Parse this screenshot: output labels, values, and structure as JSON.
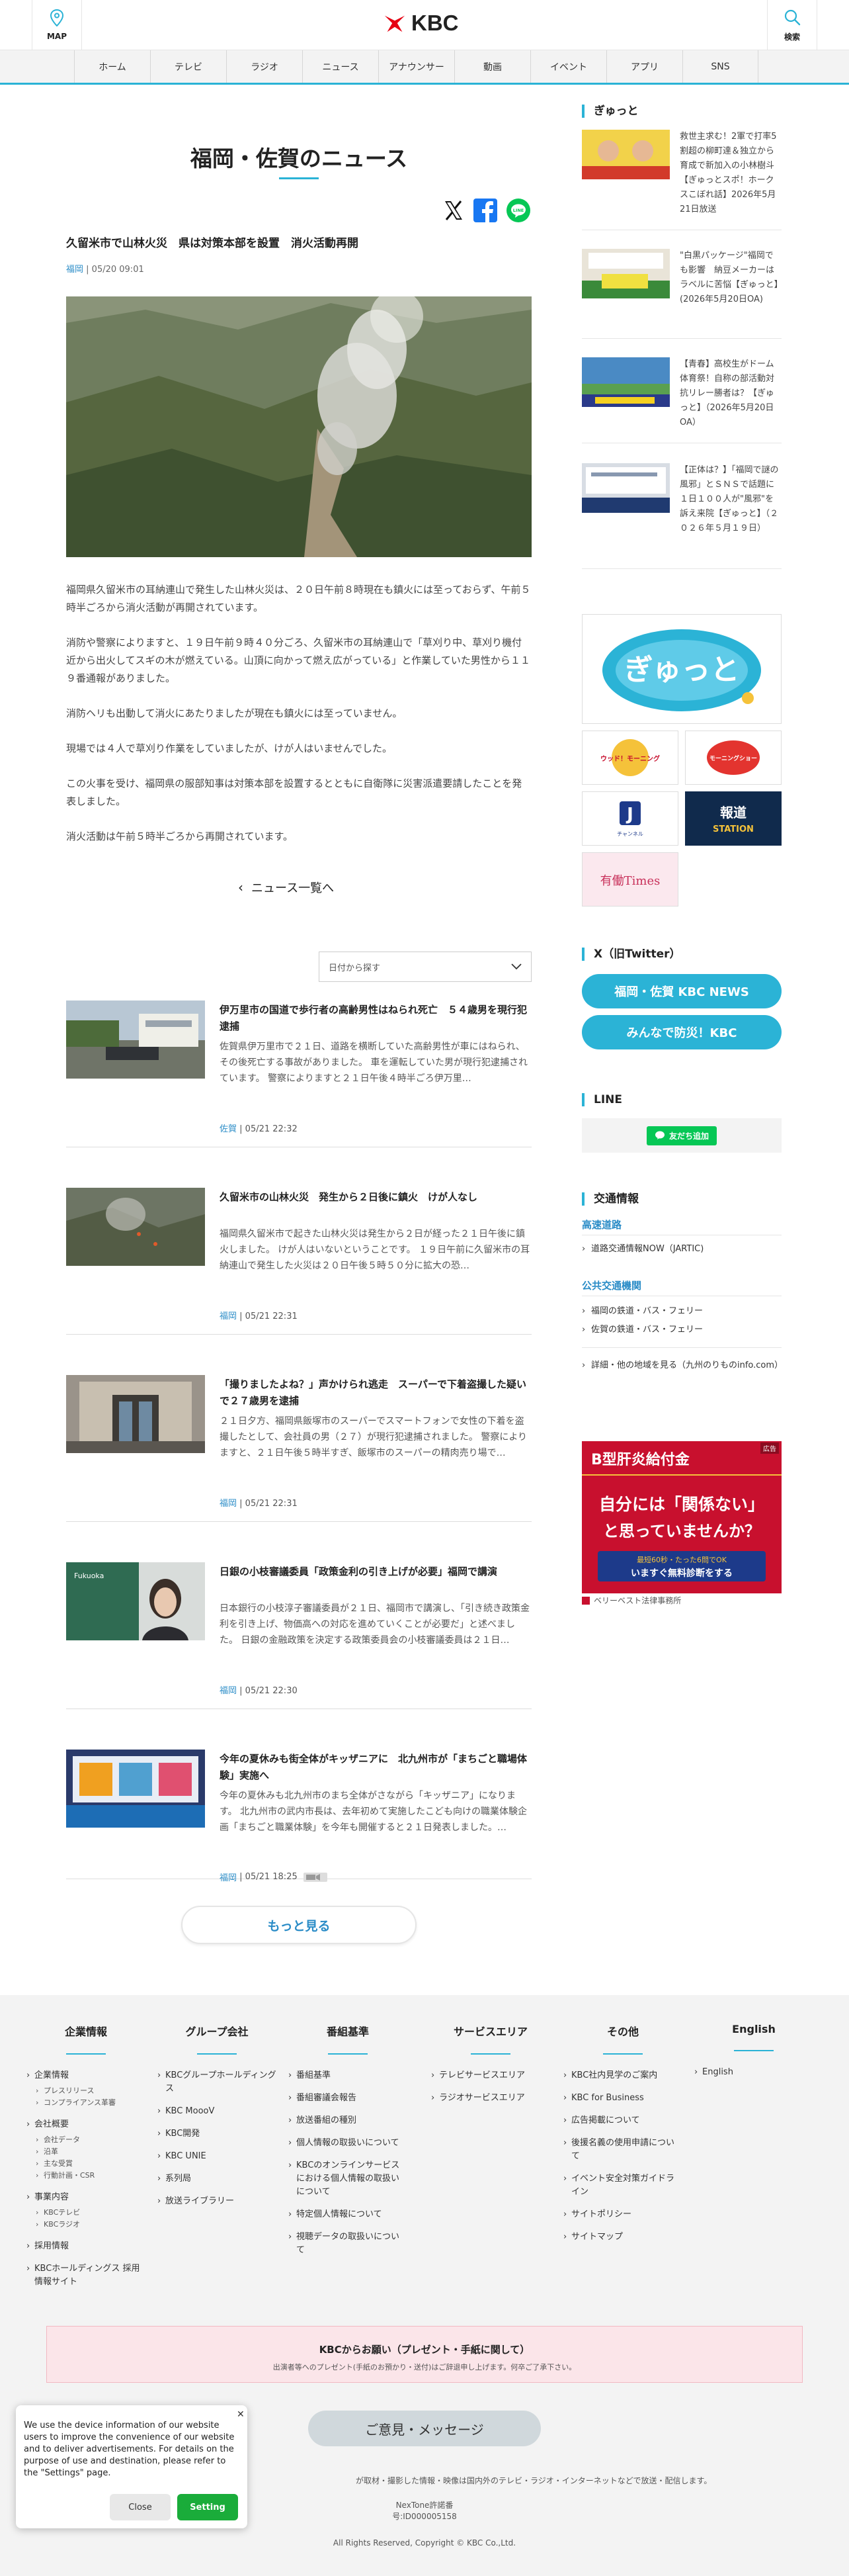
{
  "header": {
    "map_label": "MAP",
    "logo_text": "KBC",
    "search_label": "検索"
  },
  "nav": {
    "items": [
      "ホーム",
      "テレビ",
      "ラジオ",
      "ニュース",
      "アナウンサー",
      "動画",
      "イベント",
      "アプリ",
      "SNS"
    ]
  },
  "main": {
    "page_title": "福岡・佐賀のニュース",
    "article": {
      "title": "久留米市で山林火災　県は対策本部を設置　消火活動再開",
      "category": "福岡",
      "date": "05/20 09:01",
      "paragraphs": [
        "福岡県久留米市の耳納連山で発生した山林火災は、２０日午前８時現在も鎮火には至っておらず、午前５時半ごろから消火活動が再開されています。",
        "消防や警察によりますと、１９日午前９時４０分ごろ、久留米市の耳納連山で「草刈り中、草刈り機付近から出火してスギの木が燃えている。山頂に向かって燃え広がっている」と作業していた男性から１１９番通報がありました。",
        "消防ヘリも出動して消火にあたりましたが現在も鎮火には至っていません。",
        "現場では４人で草刈り作業をしていましたが、けが人はいませんでした。",
        "この火事を受け、福岡県の服部知事は対策本部を設置するとともに自衛隊に災害派遣要請したことを発表しました。",
        "消火活動は午前５時半ごろから再開されています。"
      ]
    },
    "back_link": "ニュース一覧へ",
    "date_select": "日付から探す",
    "news": [
      {
        "title": "伊万里市の国道で歩行者の高齢男性はねられ死亡　５４歳男を現行犯逮捕",
        "excerpt": "佐賀県伊万里市で２１日、道路を横断していた高齢男性が車にはねられ、その後死亡する事故がありました。 車を運転していた男が現行犯逮捕されています。 警察によりますと２１日午後４時半ごろ伊万里…",
        "category": "佐賀",
        "date": "05/21 22:32"
      },
      {
        "title": "久留米市の山林火災　発生から２日後に鎮火　けが人なし",
        "excerpt": "福岡県久留米市で起きた山林火災は発生から２日が経った２１日午後に鎮火しました。 けが人はいないということです。 １９日午前に久留米市の耳納連山で発生した火災は２０日午後５時５０分に拡大の恐…",
        "category": "福岡",
        "date": "05/21 22:31"
      },
      {
        "title": "「撮りましたよね？」声かけられ逃走　スーパーで下着盗撮した疑いで２７歳男を逮捕",
        "excerpt": "２１日夕方、福岡県飯塚市のスーパーでスマートフォンで女性の下着を盗撮したとして、会社員の男（２７）が現行犯逮捕されました。 警察によりますと、２１日午後５時半すぎ、飯塚市のスーパーの精肉売り場で…",
        "category": "福岡",
        "date": "05/21 22:31"
      },
      {
        "title": "日銀の小枝審議委員「政策金利の引き上げが必要」福岡で講演",
        "excerpt": "日本銀行の小枝淳子審議委員が２１日、福岡市で講演し、「引き続き政策金利を引き上げ、物価高への対応を進めていくことが必要だ」と述べました。 日銀の金融政策を決定する政策委員会の小枝審議委員は２１日…",
        "category": "福岡",
        "date": "05/21 22:30"
      },
      {
        "title": "今年の夏休みも街全体がキッザニアに　北九州市が「まちごと職場体験」実施へ",
        "excerpt": "今年の夏休みも北九州市のまち全体がさながら「キッザニア」になります。 北九州市の武内市長は、去年初めて実施したこども向けの職業体験企画「まちごと職業体験」を今年も開催すると２１日発表しました。…",
        "category": "福岡",
        "date": "05/21 18:25"
      }
    ],
    "more_button": "もっと見る"
  },
  "sidebar": {
    "gyutto_head": "ぎゅっと",
    "gyutto_items": [
      "救世主求む！2軍で打率5割超の柳町達＆独立から育成で新加入の小林樹斗【ぎゅっとスポ！ホークスこぼれ話】2026年5月21日放送",
      "\"白黒パッケージ\"福岡でも影響　納豆メーカーはラベルに苦悩【ぎゅっと】(2026年5月20日OA)",
      "【青春】高校生がドーム体育祭！自称の部活動対抗リレー勝者は？【ぎゅっと】（2026年5月20日OA）",
      "【正体は？】「福岡で謎の風邪」とＳＮＳで話題に　１日１００人が\"風邪\"を訴え来院【ぎゅっと】（２０２６年５月１９日）"
    ],
    "banners": {
      "gyutto_logo": "ぎゅっと",
      "wakuwaku": "ウッド！モーニング",
      "morning_show": "モーニングショー",
      "j_channel": "チャンネル",
      "houdou_top": "報道",
      "houdou_bottom": "STATION",
      "times": "有働Times"
    },
    "x_head": "X（旧Twitter）",
    "x_buttons": [
      "福岡・佐賀 KBC NEWS",
      "みんなで防災！KBC"
    ],
    "line_head": "LINE",
    "line_add": "友だち追加",
    "traffic_head": "交通情報",
    "traffic_road": "高速道路",
    "traffic_road_link": "道路交通情報NOW（JARTIC)",
    "traffic_public": "公共交通機関",
    "traffic_links": [
      "福岡の鉄道・バス・フェリー",
      "佐賀の鉄道・バス・フェリー"
    ],
    "traffic_other": "詳細・他の地域を見る（九州のりものinfo.com）",
    "ad": {
      "label": "広告",
      "title": "B型肝炎給付金",
      "line1": "自分には「関係ない」",
      "line2": "と思っていませんか？",
      "cta_top": "最短60秒・たった6問でOK",
      "cta": "いますぐ無料診断をする",
      "sponsor": "ベリーベスト法律事務所"
    }
  },
  "footer": {
    "columns": [
      {
        "title": "企業情報",
        "groups": [
          {
            "link": "企業情報",
            "subs": [
              "プレスリリース",
              "コンプライアンス革審"
            ]
          },
          {
            "link": "会社概要",
            "subs": [
              "会社データ",
              "沿革",
              "主な受賞",
              "行動計画・CSR"
            ]
          },
          {
            "link": "事業内容",
            "subs": [
              "KBCテレビ",
              "KBCラジオ"
            ]
          },
          {
            "link": "採用情報",
            "subs": []
          },
          {
            "link": "KBCホールディングス 採用情報サイト",
            "subs": []
          }
        ]
      },
      {
        "title": "グループ会社",
        "groups": [
          {
            "link": "KBCグループホールディングス",
            "subs": []
          },
          {
            "link": "KBC MoooV",
            "subs": []
          },
          {
            "link": "KBC開発",
            "subs": []
          },
          {
            "link": "KBC UNIE",
            "subs": []
          },
          {
            "link": "系列局",
            "subs": []
          },
          {
            "link": "放送ライブラリー",
            "subs": []
          }
        ]
      },
      {
        "title": "番組基準",
        "groups": [
          {
            "link": "番組基準",
            "subs": []
          },
          {
            "link": "番組審議会報告",
            "subs": []
          },
          {
            "link": "放送番組の種別",
            "subs": []
          },
          {
            "link": "個人情報の取扱いについて",
            "subs": []
          },
          {
            "link": "KBCのオンラインサービスにおける個人情報の取扱いについて",
            "subs": []
          },
          {
            "link": "特定個人情報について",
            "subs": []
          },
          {
            "link": "視聴データの取扱いについて",
            "subs": []
          }
        ]
      },
      {
        "title": "サービスエリア",
        "groups": [
          {
            "link": "テレビサービスエリア",
            "subs": []
          },
          {
            "link": "ラジオサービスエリア",
            "subs": []
          }
        ]
      },
      {
        "title": "その他",
        "groups": [
          {
            "link": "KBC社内見学のご案内",
            "subs": []
          },
          {
            "link": "KBC for Business",
            "subs": []
          },
          {
            "link": "広告掲載について",
            "subs": []
          },
          {
            "link": "後援名義の使用申請について",
            "subs": []
          },
          {
            "link": "イベント安全対策ガイドライン",
            "subs": []
          },
          {
            "link": "サイトポリシー",
            "subs": []
          },
          {
            "link": "サイトマップ",
            "subs": []
          }
        ]
      },
      {
        "title": "English",
        "groups": [
          {
            "link": "English",
            "subs": []
          }
        ]
      }
    ],
    "present_title": "KBCからお願い（プレゼント・手紙に関して）",
    "present_sub": "出演者等へのプレゼント(手紙のお預かり・送付)はご辞退申し上げます。何卒ご了承下さい。",
    "opinion": "ご意見・メッセージ",
    "notice": "が取材・撮影した情報・映像は国内外のテレビ・ラジオ・インターネットなどで放送・配信します。",
    "license": "NexTone許諾番号:ID000005158",
    "copyright": "All Rights Reserved, Copyright © KBC Co.,Ltd."
  },
  "cookie": {
    "message": "We use the device information of our website users to improve the convenience of our website and to deliver advertisements. For details on the purpose of use and destination, please refer to the \"Settings\" page.",
    "close": "Close",
    "setting": "Setting"
  },
  "colors": {
    "accent": "#2bb3d6",
    "link": "#2a8cc7",
    "logo_red": "#e60012",
    "line_green": "#06c755"
  }
}
